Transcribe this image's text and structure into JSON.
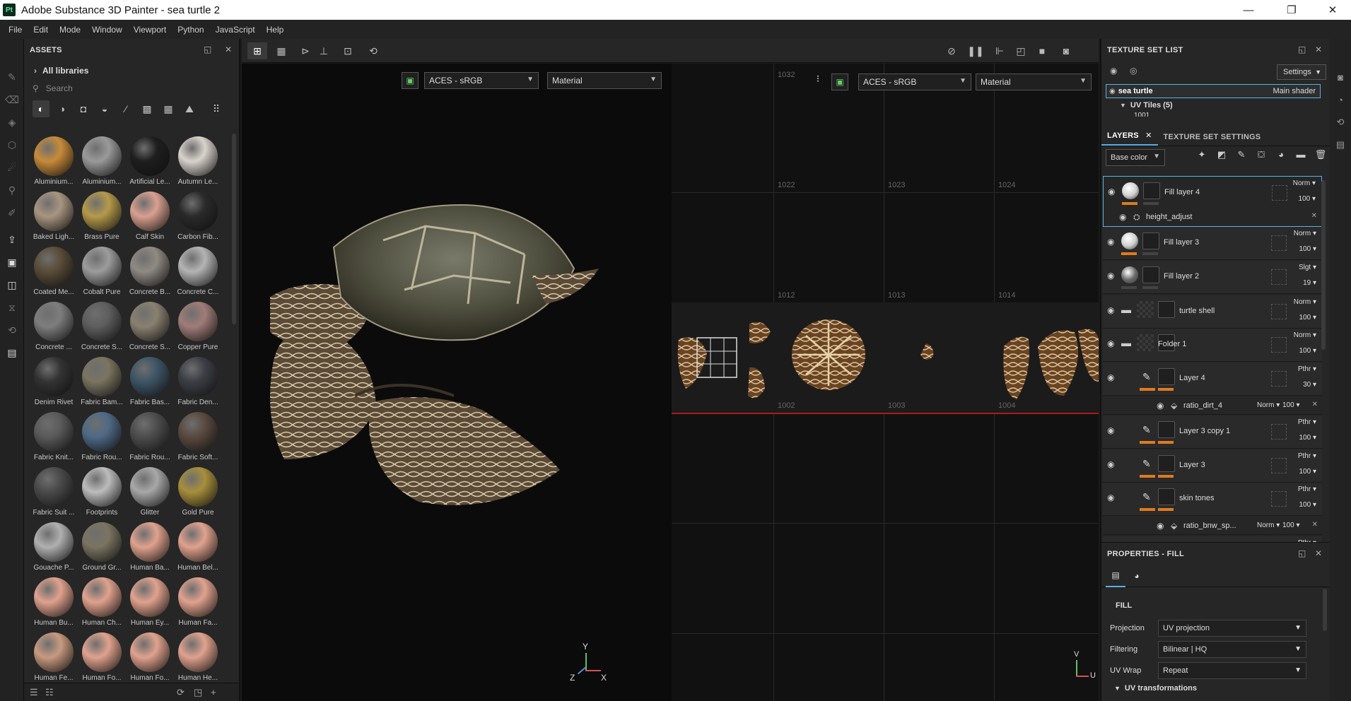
{
  "window": {
    "title": "Adobe Substance 3D Painter - sea turtle 2",
    "logo": "Pt",
    "minimize": "—",
    "maximize": "❐",
    "close": "✕"
  },
  "menu": [
    "File",
    "Edit",
    "Mode",
    "Window",
    "Viewport",
    "Python",
    "JavaScript",
    "Help"
  ],
  "assets": {
    "title": "ASSETS",
    "library": "All libraries",
    "search_placeholder": "Search",
    "items": [
      {
        "name": "Aluminium...",
        "color": "#c88b3a"
      },
      {
        "name": "Aluminium...",
        "color": "#9a9a9a"
      },
      {
        "name": "Artificial Le...",
        "color": "#1e1e1e"
      },
      {
        "name": "Autumn Le...",
        "color": "#d9d3cc"
      },
      {
        "name": "Baked Ligh...",
        "color": "#a89580"
      },
      {
        "name": "Brass Pure",
        "color": "#b59a4a"
      },
      {
        "name": "Calf Skin",
        "color": "#d9a090"
      },
      {
        "name": "Carbon Fib...",
        "color": "#2a2a2a"
      },
      {
        "name": "Coated Me...",
        "color": "#5a4c38"
      },
      {
        "name": "Cobalt Pure",
        "color": "#9c9c9c"
      },
      {
        "name": "Concrete B...",
        "color": "#8f8a82"
      },
      {
        "name": "Concrete C...",
        "color": "#b4b4b4"
      },
      {
        "name": "Concrete ...",
        "color": "#7d7d7d"
      },
      {
        "name": "Concrete S...",
        "color": "#5e5e5e"
      },
      {
        "name": "Concrete S...",
        "color": "#8a8070"
      },
      {
        "name": "Copper Pure",
        "color": "#a07c78"
      },
      {
        "name": "Denim Rivet",
        "color": "#333333"
      },
      {
        "name": "Fabric Bam...",
        "color": "#7a7460"
      },
      {
        "name": "Fabric Bas...",
        "color": "#3e5566"
      },
      {
        "name": "Fabric Den...",
        "color": "#3b3f45"
      },
      {
        "name": "Fabric Knit...",
        "color": "#5a5a5a"
      },
      {
        "name": "Fabric Rou...",
        "color": "#4f6a85"
      },
      {
        "name": "Fabric Rou...",
        "color": "#4d4d4d"
      },
      {
        "name": "Fabric Soft...",
        "color": "#5a4a40"
      },
      {
        "name": "Fabric Suit ...",
        "color": "#4a4a4a"
      },
      {
        "name": "Footprints",
        "color": "#bcbcbc"
      },
      {
        "name": "Glitter",
        "color": "#a8a8a8"
      },
      {
        "name": "Gold Pure",
        "color": "#a88f3c"
      },
      {
        "name": "Gouache P...",
        "color": "#b0b0b0"
      },
      {
        "name": "Ground Gr...",
        "color": "#7a7460"
      },
      {
        "name": "Human Ba...",
        "color": "#e0a28e"
      },
      {
        "name": "Human Bel...",
        "color": "#e0a28e"
      },
      {
        "name": "Human Bu...",
        "color": "#e0a28e"
      },
      {
        "name": "Human Ch...",
        "color": "#e0a28e"
      },
      {
        "name": "Human Ey...",
        "color": "#e0a28e"
      },
      {
        "name": "Human Fa...",
        "color": "#e0a28e"
      },
      {
        "name": "Human Fe...",
        "color": "#c89a80"
      },
      {
        "name": "Human Fo...",
        "color": "#e0a28e"
      },
      {
        "name": "Human Fo...",
        "color": "#e0a28e"
      },
      {
        "name": "Human He...",
        "color": "#e0a28e"
      }
    ]
  },
  "viewport": {
    "colorspace_left": "ACES - sRGB",
    "mode_left": "Material",
    "colorspace_right": "ACES - sRGB",
    "mode_right": "Material",
    "uv_labels": [
      "1032",
      "1022",
      "1023",
      "1024",
      "1012",
      "1013",
      "1014",
      "1002",
      "1003",
      "1004"
    ],
    "axis_3d": {
      "y": "Y",
      "z": "Z",
      "x": "X"
    },
    "axis_2d": {
      "v": "V",
      "u": "U"
    }
  },
  "texture_set_list": {
    "title": "TEXTURE SET LIST",
    "settings_label": "Settings",
    "set_name": "sea turtle",
    "shader": "Main shader",
    "uv_tiles": "UV Tiles (5)",
    "tile_partial": "1001"
  },
  "layers_tab": {
    "layers": "LAYERS",
    "texture_set_settings": "TEXTURE SET SETTINGS",
    "channel": "Base color"
  },
  "layers": [
    {
      "name": "Fill layer 4",
      "blend": "Norm",
      "opacity": "100",
      "type": "fill",
      "thumb": "#d0d0d0",
      "selected": true
    },
    {
      "name": "Fill layer 3",
      "blend": "Norm",
      "opacity": "100",
      "type": "fill",
      "thumb": "#cfcfcf"
    },
    {
      "name": "Fill layer 2",
      "blend": "Slgt",
      "opacity": "19",
      "type": "fill",
      "thumb": "#6a6a6a"
    },
    {
      "name": "turtle shell",
      "blend": "Norm",
      "opacity": "100",
      "type": "folder"
    },
    {
      "name": "Folder 1",
      "blend": "Norm",
      "opacity": "100",
      "type": "folder"
    },
    {
      "name": "Layer 4",
      "blend": "Pthr",
      "opacity": "30",
      "type": "paint"
    },
    {
      "name": "Layer 3 copy 1",
      "blend": "Pthr",
      "opacity": "100",
      "type": "paint"
    },
    {
      "name": "Layer 3",
      "blend": "Pthr",
      "opacity": "100",
      "type": "paint"
    },
    {
      "name": "skin tones",
      "blend": "Pthr",
      "opacity": "100",
      "type": "paint"
    },
    {
      "name": "",
      "blend": "Pthr",
      "opacity": "",
      "type": "paint"
    }
  ],
  "effects": [
    {
      "name": "height_adjust",
      "blend": "",
      "opacity": ""
    },
    {
      "name": "ratio_dirt_4",
      "blend": "Norm",
      "opacity": "100"
    },
    {
      "name": "ratio_bnw_sp...",
      "blend": "Norm",
      "opacity": "100"
    }
  ],
  "properties": {
    "title": "PROPERTIES - FILL",
    "section": "FILL",
    "rows": [
      {
        "label": "Projection",
        "value": "UV projection"
      },
      {
        "label": "Filtering",
        "value": "Bilinear | HQ"
      },
      {
        "label": "UV Wrap",
        "value": "Repeat"
      }
    ],
    "subsection": "UV transformations"
  }
}
